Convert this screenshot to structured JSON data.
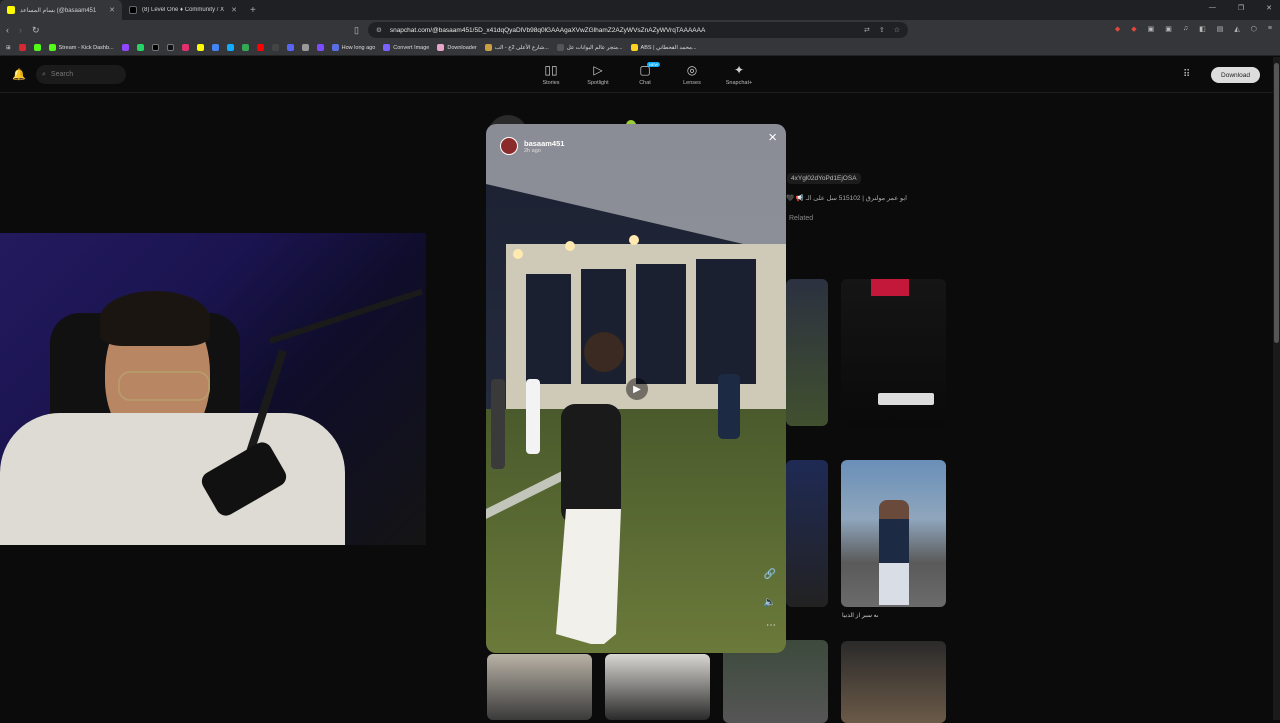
{
  "browser": {
    "tabs": [
      {
        "label": "بسام المساعد (@basaam451",
        "active": true
      },
      {
        "label": "(8) Level One ♦ Community / X",
        "active": false
      }
    ],
    "url": "snapchat.com/@basaam451/5D_x41dqQyaDlVb98q0lGAAAgaXVwZGlhamZ2AZyWVsZnAZyWVrqTAAAAAA",
    "bookmarks": [
      "Stream - Kick Dashb...",
      "How long ago",
      "Convert Image",
      "Downloader",
      "شارع الأعلى 2ع - الب...",
      "متجر عالم البوانات عل...",
      "ABS | محمد القحطاني..."
    ]
  },
  "snapchat": {
    "search_placeholder": "Search",
    "nav": [
      {
        "label": "Stories",
        "icon": "stories-icon",
        "glyph": "▯▯"
      },
      {
        "label": "Spotlight",
        "icon": "spotlight-icon",
        "glyph": "▷"
      },
      {
        "label": "Chat",
        "icon": "chat-icon",
        "glyph": "▢",
        "badge": "NEW"
      },
      {
        "label": "Lenses",
        "icon": "lenses-icon",
        "glyph": "◎"
      },
      {
        "label": "Snapchat+",
        "icon": "snapchat-plus-icon",
        "glyph": "✦"
      }
    ],
    "download_label": "Download",
    "profile_handle_snip": "4xYgl02dYoPd1EjOSA",
    "bio_snip": "🖤 📢 ابو عمر مولنرق | 515102 سل على الـ",
    "related_tab": "Related",
    "thumb_captions": [
      "ىه سبر از الدنيا"
    ]
  },
  "viewer": {
    "username": "basaam451",
    "time": "2h ago",
    "close_glyph": "×",
    "play_glyph": "▶"
  },
  "colors": {
    "accent_blue": "#0fadff",
    "chrome_dark": "#1f2024",
    "chrome_mid": "#35363a"
  }
}
